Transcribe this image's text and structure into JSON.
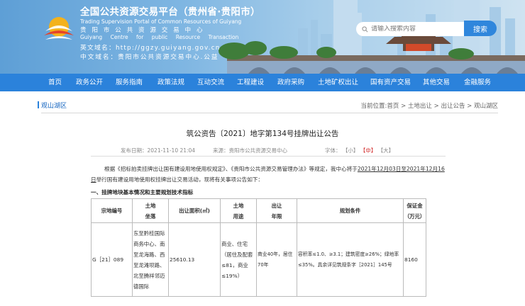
{
  "site": {
    "title": "全国公共资源交易平台（贵州省·贵阳市）",
    "subtitle_en": "Trading Supervision Portal of Common Resources of Guiyang",
    "center_cn": "贵阳市公共资源交易中心",
    "center_en": "Guiyang Centre for public Resource Transaction",
    "domain_en_label": "英文域名：http://ggzy.guiyang.gov.cn",
    "domain_cn_label": "中文域名：贵阳市公共资源交易中心.公益"
  },
  "search": {
    "placeholder": "请输入搜索内容",
    "button": "搜索"
  },
  "nav": {
    "items": [
      {
        "label": "首页"
      },
      {
        "label": "政务公开"
      },
      {
        "label": "服务指南"
      },
      {
        "label": "政策法规"
      },
      {
        "label": "互动交流"
      },
      {
        "label": "工程建设"
      },
      {
        "label": "政府采购"
      },
      {
        "label": "土地矿权出让"
      },
      {
        "label": "国有资产交易"
      },
      {
        "label": "其他交易"
      },
      {
        "label": "金融服务"
      }
    ]
  },
  "breadcrumb": {
    "section": "观山湖区",
    "path": "当前位置:首页 > 土地出让 > 出让公告 > 观山湖区"
  },
  "article": {
    "title": "筑公资告〔2021〕地字第134号挂牌出让公告",
    "publish_time": "发布日期：2021-11-10 21:04",
    "source": "来源：贵阳市公共资源交易中心",
    "font_label": "字体：",
    "font_small": "【小】",
    "font_medium": "【中】",
    "font_large": "【大】",
    "para1_a": "根据《招标拍卖挂牌出让国有建设用地使用权规定》、《贵阳市公共资源交易管理办法》等规定，我中心将于",
    "para1_date": "2021年12月03日至2021年12月16",
    "para2_date": "日",
    "para2_b": "举行国有建设用地使用权挂牌出让交易活动，现将有关事项公告如下：",
    "section1": "一、挂牌地块基本情况和主要规划技术指标"
  },
  "table": {
    "headers": {
      "code": "宗地编号",
      "location_1": "土地",
      "location_2": "坐落",
      "area": "出让面积(㎡)",
      "use_1": "土地",
      "use_2": "用途",
      "term_1": "出让",
      "term_2": "年限",
      "conditions": "规划条件",
      "deposit_1": "保证金",
      "deposit_2": "（万元）"
    },
    "row": {
      "code": "G［21］089",
      "location_lines": [
        "东至黔桂国际",
        "商务中心、南",
        "至龙海路、西",
        "至龙滩坝路、",
        "北至腾祥邻迈",
        "德国际"
      ],
      "area": "25610.13",
      "use_lines": [
        "商业、住宅",
        "（居住及配套",
        "≤81，商业",
        "≤19%）"
      ],
      "term": "商业40年，居住70年",
      "conditions_lines": [
        "容积率≤1.0、≥3.1；建筑密度≥26%；绿地率",
        "≤35%。具余详见筑规条字［2021］145号"
      ],
      "deposit": "8160"
    }
  }
}
